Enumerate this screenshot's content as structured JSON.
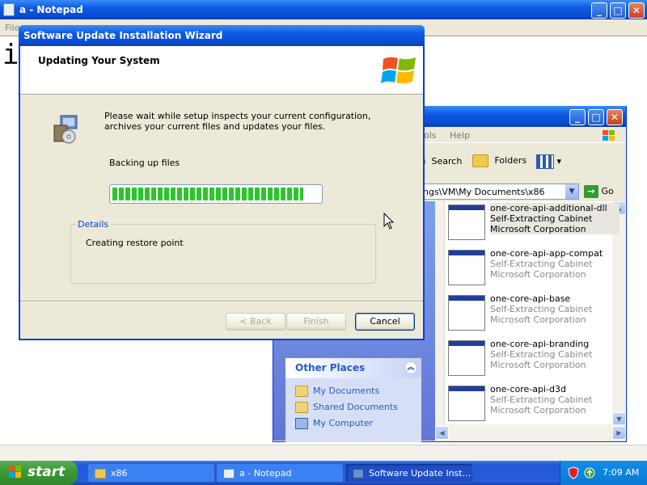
{
  "notepad": {
    "title": "a - Notepad",
    "menu_partial": "File",
    "text_partial": "i",
    "controls": {
      "minimize": "_",
      "maximize": "□",
      "close": "✕"
    }
  },
  "explorer": {
    "menu": {
      "tools_partial": "ols",
      "help": "Help"
    },
    "toolbar": {
      "search": "Search",
      "folders": "Folders",
      "views_arrow": "▾"
    },
    "address": {
      "value": "ngs\\VM\\My Documents\\x86",
      "go": "Go",
      "go_arrow": "→",
      "dropdown": "▼"
    },
    "other_places": {
      "title": "Other Places",
      "collapse": "︽",
      "items": [
        "My Documents",
        "Shared Documents",
        "My Computer"
      ]
    },
    "files": [
      {
        "name": "one-core-api-additional-dll",
        "type": "Self-Extracting Cabinet",
        "company": "Microsoft Corporation"
      },
      {
        "name": "one-core-api-app-compat",
        "type": "Self-Extracting Cabinet",
        "company": "Microsoft Corporation"
      },
      {
        "name": "one-core-api-base",
        "type": "Self-Extracting Cabinet",
        "company": "Microsoft Corporation"
      },
      {
        "name": "one-core-api-branding",
        "type": "Self-Extracting Cabinet",
        "company": "Microsoft Corporation"
      },
      {
        "name": "one-core-api-d3d",
        "type": "Self-Extracting Cabinet",
        "company": "Microsoft Corporation"
      }
    ],
    "scroll": {
      "up": "▲",
      "down": "▼",
      "left": "◀",
      "right": "▶"
    }
  },
  "wizard": {
    "title": "Software Update Installation Wizard",
    "heading": "Updating Your System",
    "description": "Please wait while setup inspects your current configuration, archives your current files and updates your files.",
    "status": "Backing up files",
    "progress": 0.92,
    "details_label": "Details",
    "details_text": "Creating restore point",
    "buttons": {
      "back": "< Back",
      "finish": "Finish",
      "cancel": "Cancel"
    }
  },
  "taskbar": {
    "start": "start",
    "tasks": [
      {
        "label": "x86",
        "active": false
      },
      {
        "label": "a - Notepad",
        "active": false
      },
      {
        "label": "Software Update Inst...",
        "active": true
      }
    ],
    "clock": "7:09 AM"
  },
  "colors": {
    "xp_blue": "#0a4ad0",
    "progress_green": "#2dc52d",
    "link_blue": "#215dc6"
  }
}
